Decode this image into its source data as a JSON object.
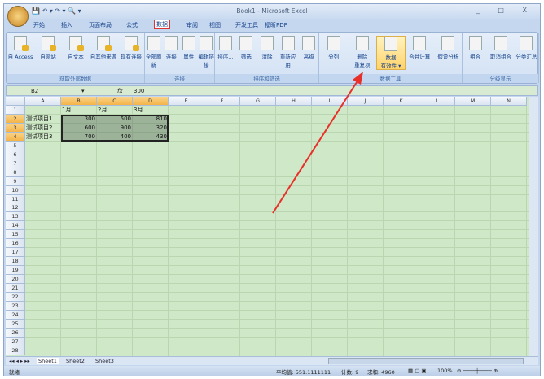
{
  "window": {
    "title": "Book1 - Microsoft Excel",
    "controls": "_ □ X"
  },
  "tabs": [
    "开始",
    "插入",
    "页面布局",
    "公式",
    "数据",
    "审阅",
    "视图",
    "开发工具",
    "福昕PDF"
  ],
  "ribbon": {
    "groups": [
      {
        "label": "获取外部数据",
        "buttons": [
          "自 Access",
          "自网站",
          "自文本",
          "自其他来源",
          "现有连接"
        ]
      },
      {
        "label": "连接",
        "buttons": [
          "全部刷新",
          "连接",
          "属性",
          "编辑链接"
        ]
      },
      {
        "label": "排序和筛选",
        "buttons": [
          "排序...",
          "筛选",
          "清除",
          "重新应用",
          "高级"
        ]
      },
      {
        "label": "数据工具",
        "buttons": [
          "分列",
          "删除\n重复项",
          "数据\n有效性 ▾",
          "合并计算",
          "假设分析"
        ]
      },
      {
        "label": "分级显示",
        "buttons": [
          "组合",
          "取消组合",
          "分类汇总"
        ]
      }
    ]
  },
  "formula_bar": {
    "name_box": "B2",
    "fx": "fx",
    "value": "300"
  },
  "columns": [
    "A",
    "B",
    "C",
    "D",
    "E",
    "F",
    "G",
    "H",
    "I",
    "J",
    "K",
    "L",
    "M",
    "N"
  ],
  "rows": 28,
  "cells": {
    "B1": "1月",
    "C1": "2月",
    "D1": "3月",
    "A2": "测试项目1",
    "B2": "300",
    "C2": "500",
    "D2": "810",
    "A3": "测试项目2",
    "B3": "600",
    "C3": "900",
    "D3": "320",
    "A4": "测试项目3",
    "B4": "700",
    "C4": "400",
    "D4": "430"
  },
  "sheets": [
    "Sheet1",
    "Sheet2",
    "Sheet3"
  ],
  "status": {
    "ready": "就绪",
    "average": "平均值: 551.1111111",
    "count": "计数: 9",
    "sum": "求和: 4960",
    "zoom": "100%"
  },
  "colors": {
    "highlight": "#e03030",
    "arrow": "#e8302a"
  }
}
